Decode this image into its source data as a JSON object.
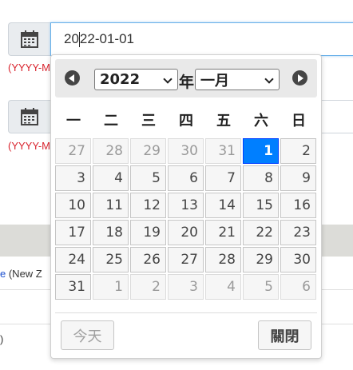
{
  "form": {
    "fields": [
      {
        "icon": "calendar-icon",
        "value_before_caret": "20",
        "value_after_caret": "22-01-01",
        "hint": "(YYYY-M"
      },
      {
        "icon": "calendar-icon",
        "value": "",
        "hint": "(YYYY-M"
      }
    ],
    "bg_link_text": "e",
    "bg_text_after_link": " (New Z",
    "bg_row_text": ")"
  },
  "datepicker": {
    "prev_icon": "chevron-left-icon",
    "next_icon": "chevron-right-icon",
    "year": "2022",
    "year_suffix": "年",
    "month": "一月",
    "weekdays": [
      "一",
      "二",
      "三",
      "四",
      "五",
      "六",
      "日"
    ],
    "weeks": [
      [
        {
          "d": "27",
          "other": true
        },
        {
          "d": "28",
          "other": true
        },
        {
          "d": "29",
          "other": true
        },
        {
          "d": "30",
          "other": true
        },
        {
          "d": "31",
          "other": true
        },
        {
          "d": "1",
          "selected": true
        },
        {
          "d": "2"
        }
      ],
      [
        {
          "d": "3"
        },
        {
          "d": "4"
        },
        {
          "d": "5"
        },
        {
          "d": "6"
        },
        {
          "d": "7"
        },
        {
          "d": "8"
        },
        {
          "d": "9"
        }
      ],
      [
        {
          "d": "10"
        },
        {
          "d": "11"
        },
        {
          "d": "12"
        },
        {
          "d": "13"
        },
        {
          "d": "14"
        },
        {
          "d": "15"
        },
        {
          "d": "16"
        }
      ],
      [
        {
          "d": "17"
        },
        {
          "d": "18"
        },
        {
          "d": "19"
        },
        {
          "d": "20"
        },
        {
          "d": "21"
        },
        {
          "d": "22"
        },
        {
          "d": "23"
        }
      ],
      [
        {
          "d": "24"
        },
        {
          "d": "25"
        },
        {
          "d": "26"
        },
        {
          "d": "27"
        },
        {
          "d": "28"
        },
        {
          "d": "29"
        },
        {
          "d": "30"
        }
      ],
      [
        {
          "d": "31"
        },
        {
          "d": "1",
          "other": true
        },
        {
          "d": "2",
          "other": true
        },
        {
          "d": "3",
          "other": true
        },
        {
          "d": "4",
          "other": true
        },
        {
          "d": "5",
          "other": true
        },
        {
          "d": "6",
          "other": true
        }
      ]
    ],
    "today_label": "今天",
    "close_label": "關閉"
  },
  "colors": {
    "selected_day": "#007fff",
    "hint_red": "#d9232d",
    "link_blue": "#1a4fd0"
  }
}
